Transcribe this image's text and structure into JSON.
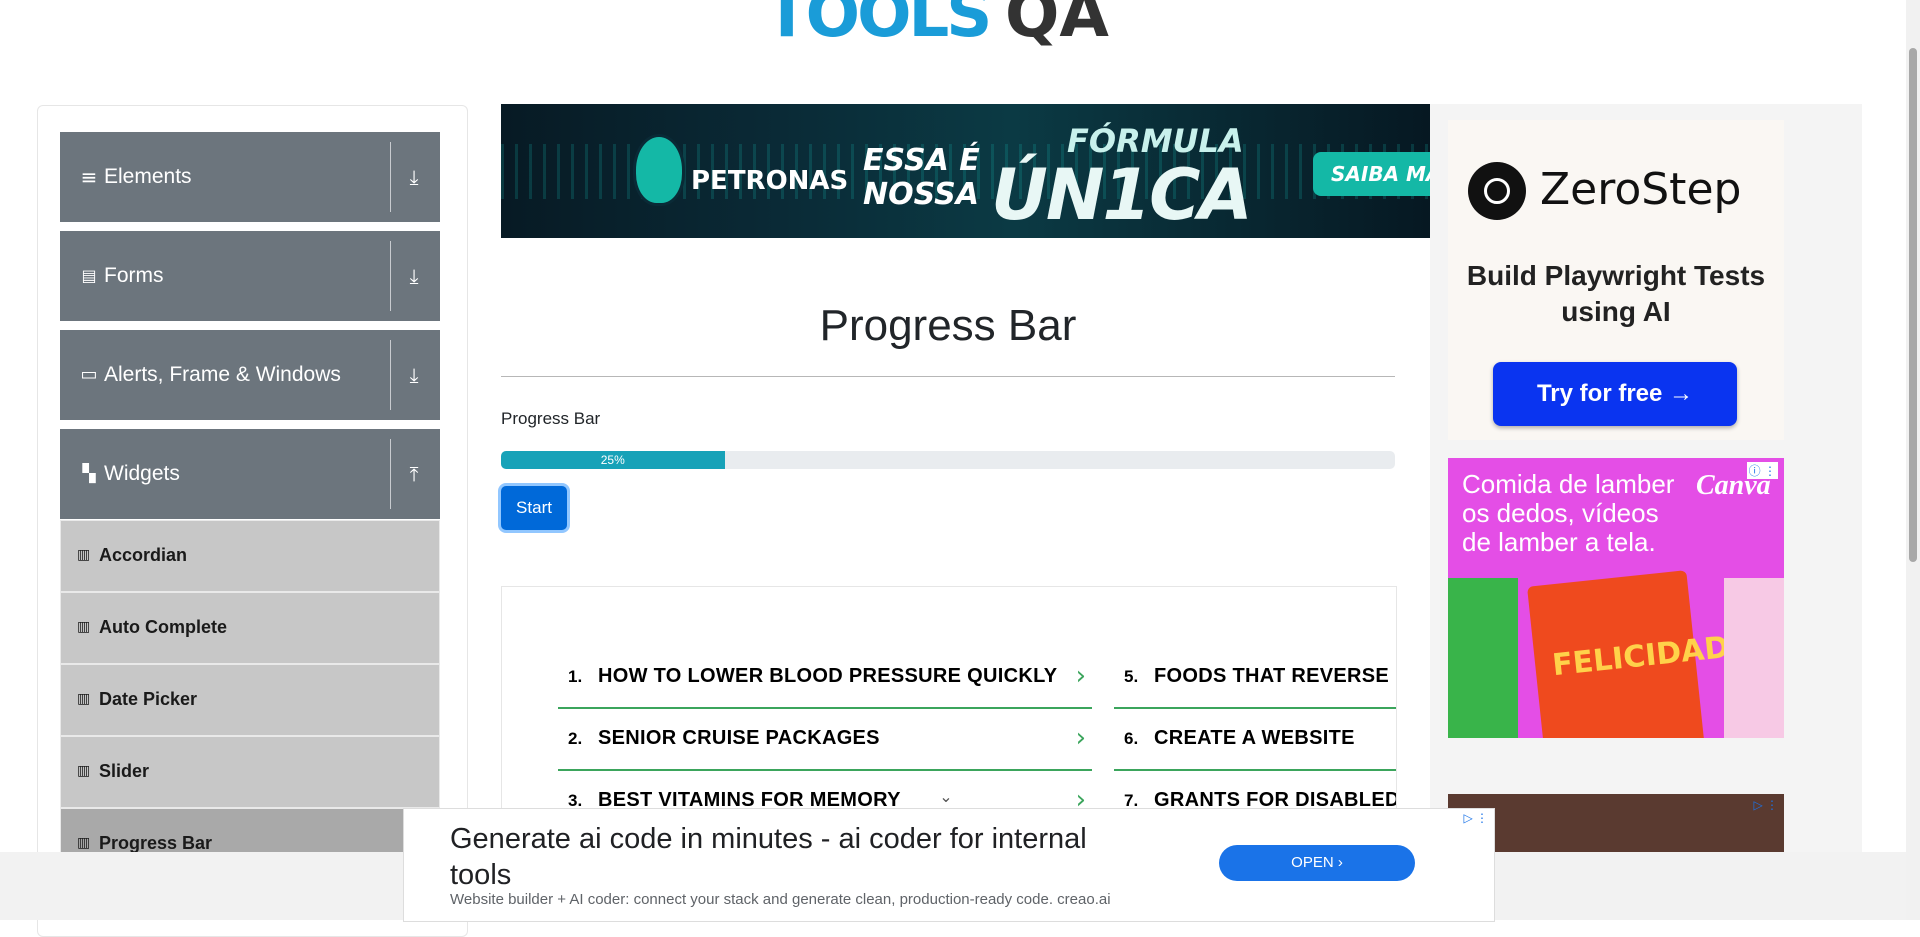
{
  "logo": {
    "text_tools": "TOOLS",
    "text_qa": "QA"
  },
  "sidebar": {
    "groups": [
      {
        "label": "Elements",
        "icon": "menu-icon",
        "arrow": "download-arrow-icon"
      },
      {
        "label": "Forms",
        "icon": "document-icon",
        "arrow": "download-arrow-icon"
      },
      {
        "label": "Alerts, Frame & Windows",
        "icon": "window-icon",
        "arrow": "download-arrow-icon"
      },
      {
        "label": "Widgets",
        "icon": "widgets-icon",
        "arrow": "upload-arrow-icon"
      }
    ],
    "widget_items": [
      "Accordian",
      "Auto Complete",
      "Date Picker",
      "Slider",
      "Progress Bar"
    ]
  },
  "top_banner": {
    "brand": "PETRONAS",
    "tagline_1": "ESSA É",
    "tagline_2": "NOSSA",
    "headline_top": "FÓRMULA",
    "headline_main": "ÚN1CA",
    "cta": "SAIBA MAI"
  },
  "main": {
    "title": "Progress Bar",
    "progress_label": "Progress Bar",
    "progress_value": 25,
    "progress_text": "25%",
    "start_button": "Start"
  },
  "link_ads": [
    {
      "num": "1.",
      "text": "HOW TO LOWER BLOOD PRESSURE QUICKLY"
    },
    {
      "num": "2.",
      "text": "SENIOR CRUISE PACKAGES"
    },
    {
      "num": "3.",
      "text": "BEST VITAMINS FOR MEMORY"
    },
    {
      "num": "5.",
      "text": "FOODS THAT REVERSE DIABE"
    },
    {
      "num": "6.",
      "text": "CREATE A WEBSITE"
    },
    {
      "num": "7.",
      "text": "GRANTS FOR DISABLED PEO"
    }
  ],
  "right_ads": {
    "zerostep": {
      "name": "ZeroStep",
      "tagline": "Build Playwright Tests using AI",
      "button": "Try for free →"
    },
    "canva": {
      "headline": "Comida de lamber os dedos, vídeos de lamber a tela.",
      "brand": "Canva",
      "pack_text": "FELICIDADE"
    }
  },
  "bottom_ad": {
    "headline": "Generate ai code in minutes - ai coder for internal tools",
    "description": "Website builder + AI coder: connect your stack and generate clean, production-ready code. creao.ai",
    "button": "OPEN ›"
  },
  "colors": {
    "sidebar_group": "#6c757d",
    "sidebar_item": "#c7c7c7",
    "progress_fill": "#17a2b8",
    "primary_button": "#0069d9",
    "link_green": "#3ba55c"
  }
}
